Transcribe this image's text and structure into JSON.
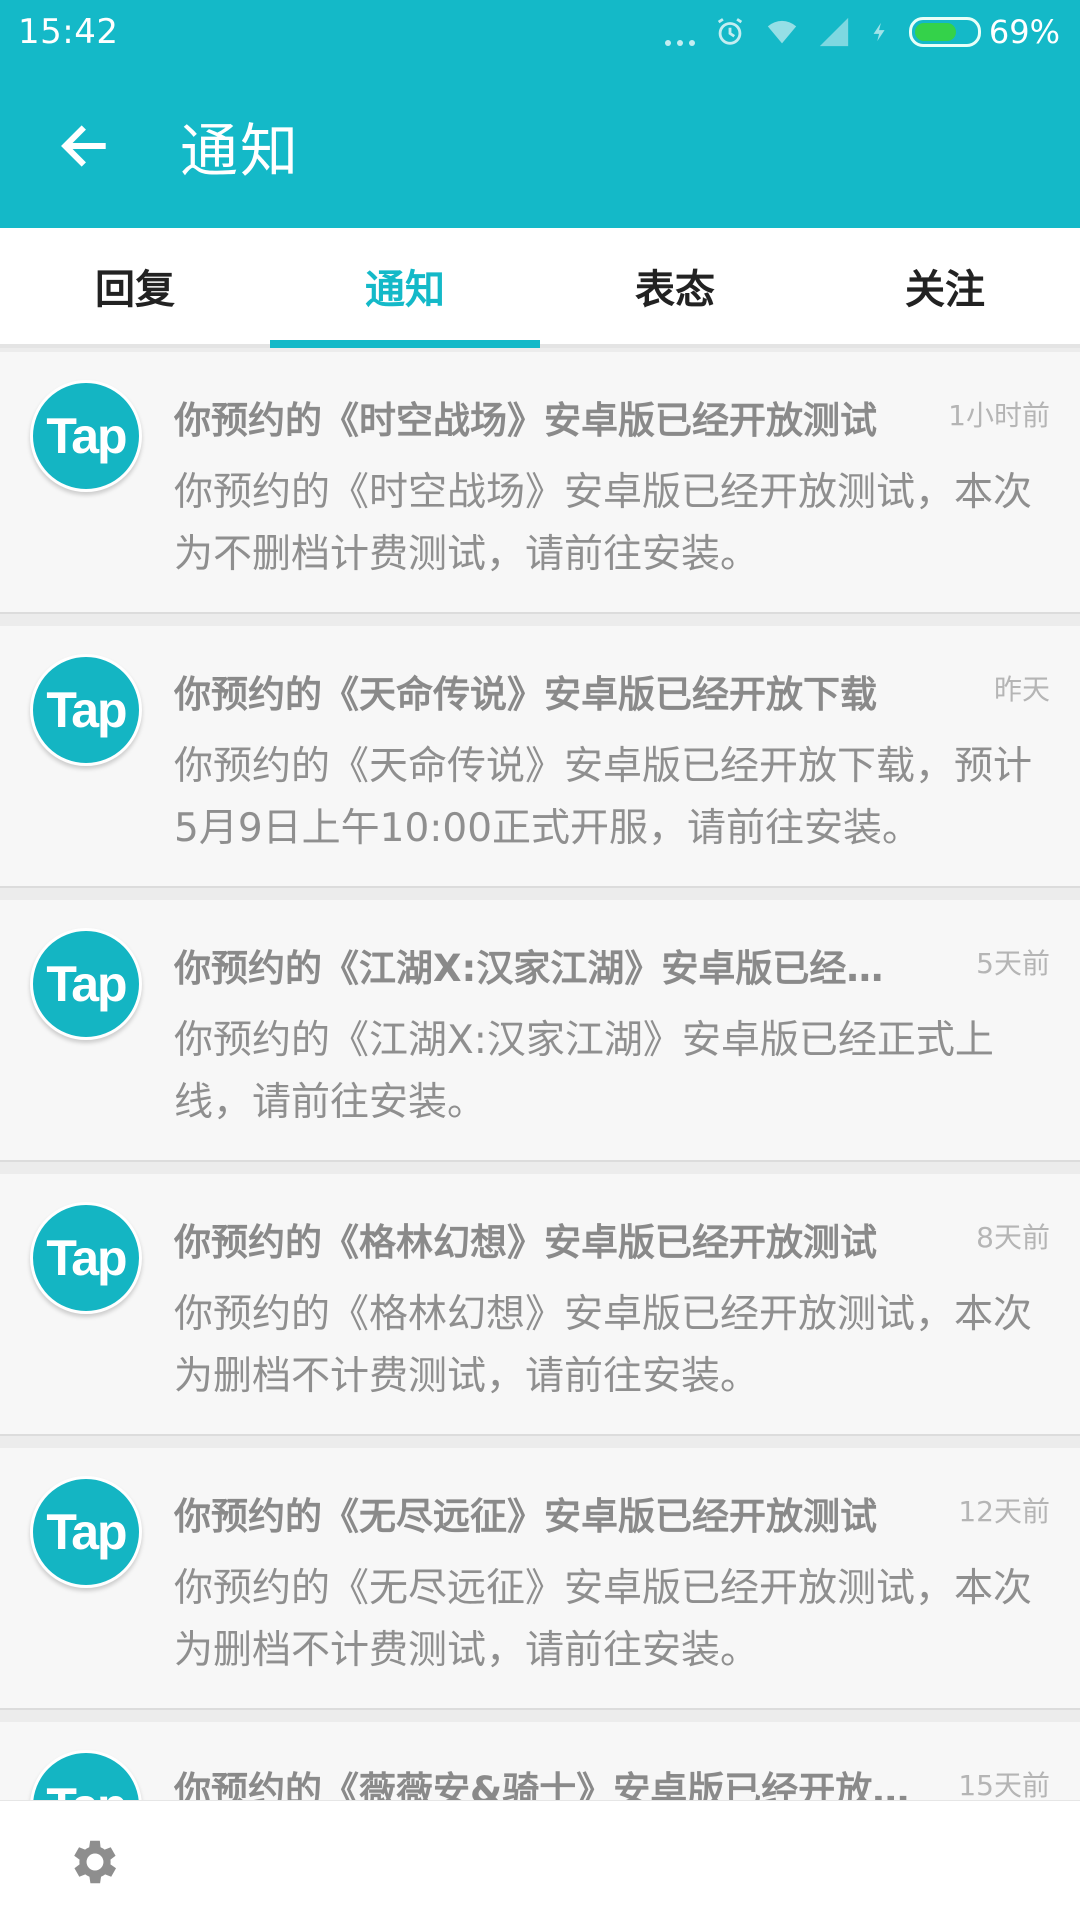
{
  "status_bar": {
    "time": "15:42",
    "battery_percent": "69%",
    "battery_level": 0.69,
    "icons": [
      "dots-icon",
      "alarm-icon",
      "wifi-icon",
      "signal-icon",
      "charging-icon",
      "battery-icon"
    ]
  },
  "toolbar": {
    "title": "通知",
    "back_icon": "arrow-left-icon"
  },
  "tabs": [
    {
      "label": "回复",
      "active": false
    },
    {
      "label": "通知",
      "active": true
    },
    {
      "label": "表态",
      "active": false
    },
    {
      "label": "关注",
      "active": false
    }
  ],
  "notifications": [
    {
      "avatar_text": "Tap",
      "title": "你预约的《时空战场》安卓版已经开放测试",
      "time": "1小时前",
      "body": "你预约的《时空战场》安卓版已经开放测试，本次为不删档计费测试，请前往安装。"
    },
    {
      "avatar_text": "Tap",
      "title": "你预约的《天命传说》安卓版已经开放下载",
      "time": "昨天",
      "body": "你预约的《天命传说》安卓版已经开放下载，预计5月9日上午10:00正式开服，请前往安装。"
    },
    {
      "avatar_text": "Tap",
      "title": "你预约的《江湖X:汉家江湖》安卓版已经正式上线",
      "time": "5天前",
      "body": "你预约的《江湖X:汉家江湖》安卓版已经正式上线，请前往安装。"
    },
    {
      "avatar_text": "Tap",
      "title": "你预约的《格林幻想》安卓版已经开放测试",
      "time": "8天前",
      "body": "你预约的《格林幻想》安卓版已经开放测试，本次为删档不计费测试，请前往安装。"
    },
    {
      "avatar_text": "Tap",
      "title": "你预约的《无尽远征》安卓版已经开放测试",
      "time": "12天前",
      "body": "你预约的《无尽远征》安卓版已经开放测试，本次为删档不计费测试，请前往安装。"
    },
    {
      "avatar_text": "Tap",
      "title": "你预约的《薇薇安&骑士》安卓版已经开放测试",
      "time": "15天前",
      "body": ""
    }
  ],
  "bottom_bar": {
    "settings_icon": "gear-icon"
  }
}
